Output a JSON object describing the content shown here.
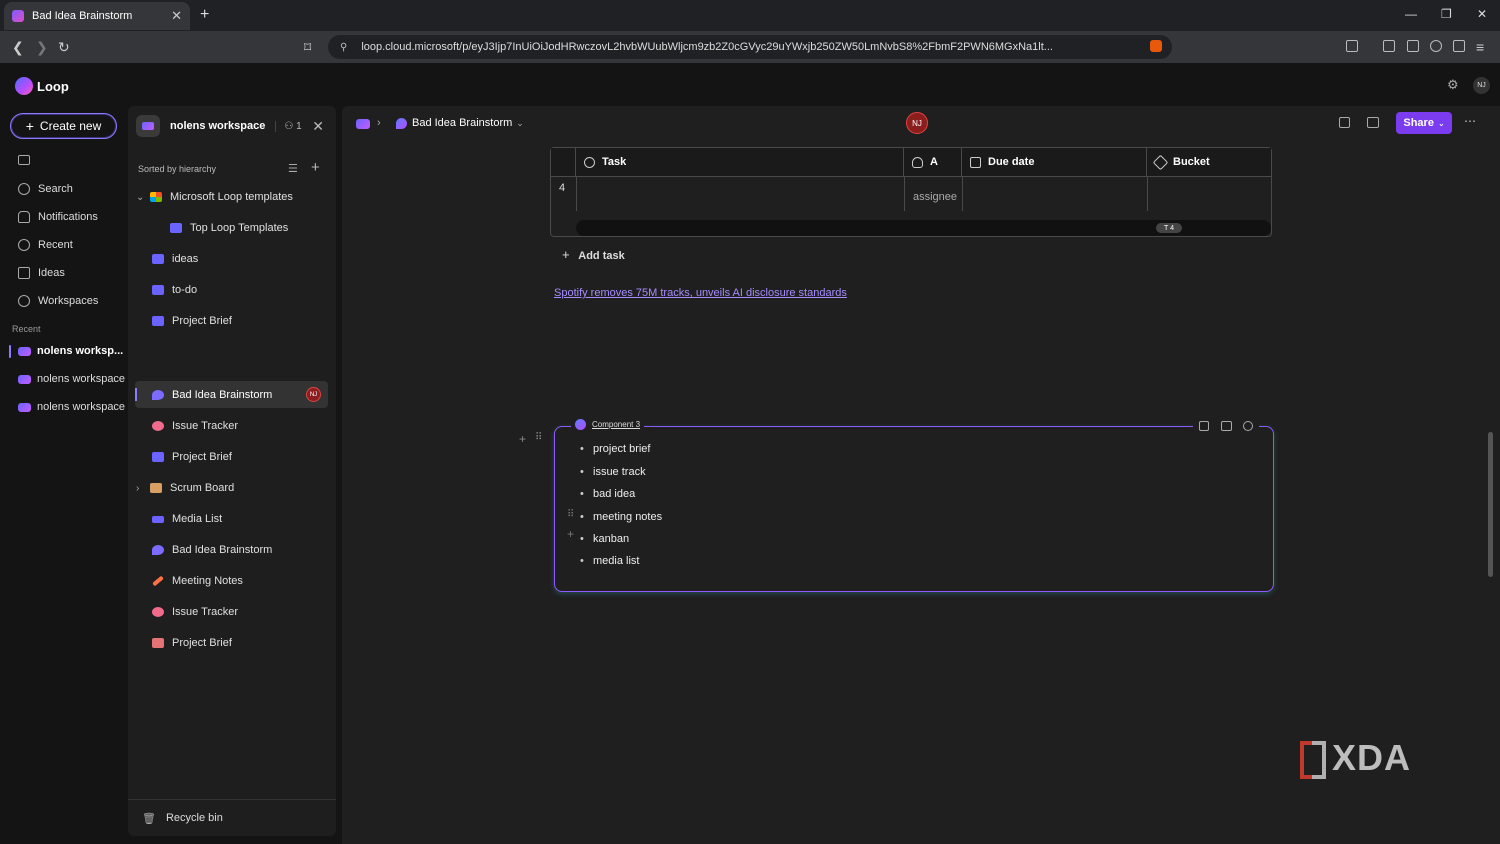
{
  "browser": {
    "tab_title": "Bad Idea Brainstorm",
    "url": "loop.cloud.microsoft/p/eyJ3Ijp7InUiOiJodHRwczovL2hvbWUubWljcm9zb2Z0cGVyc29uYWxjb250ZW50LmNvbS8%2FbmF2PWN6MGxNa1lt..."
  },
  "app": {
    "name": "Loop",
    "user_initials": "NJ"
  },
  "left_nav": {
    "create_new": "Create new",
    "items": [
      {
        "label": "Search"
      },
      {
        "label": "Notifications"
      },
      {
        "label": "Recent"
      },
      {
        "label": "Ideas"
      },
      {
        "label": "Workspaces"
      }
    ],
    "recent_label": "Recent",
    "recent": [
      {
        "label": "nolens worksp..."
      },
      {
        "label": "nolens workspace"
      },
      {
        "label": "nolens workspace"
      }
    ]
  },
  "workspace": {
    "name": "nolens workspace",
    "members": "1",
    "sort_label": "Sorted by hierarchy",
    "tree": [
      {
        "label": "Microsoft Loop templates",
        "color": "#f25022"
      },
      {
        "label": "Top Loop Templates",
        "color": "#6b63ff"
      },
      {
        "label": "ideas",
        "color": "#6b63ff"
      },
      {
        "label": "to-do",
        "color": "#6b63ff"
      },
      {
        "label": "Project Brief",
        "color": "#6b63ff"
      },
      {
        "label": "Bad Idea Brainstorm",
        "color": "#7b6cff"
      },
      {
        "label": "Issue Tracker",
        "color": "#f26b8a"
      },
      {
        "label": "Project Brief",
        "color": "#6b63ff"
      },
      {
        "label": "Scrum Board",
        "color": "#d9a066"
      },
      {
        "label": "Media List",
        "color": "#6b63ff"
      },
      {
        "label": "Bad Idea Brainstorm",
        "color": "#7b6cff"
      },
      {
        "label": "Meeting Notes",
        "color": "#ff7043"
      },
      {
        "label": "Issue Tracker",
        "color": "#f26b8a"
      },
      {
        "label": "Project Brief",
        "color": "#e57373"
      }
    ],
    "active_initials": "NJ",
    "recycle_bin": "Recycle bin"
  },
  "page": {
    "breadcrumb_title": "Bad Idea Brainstorm",
    "collaborator_initials": "NJ",
    "share_label": "Share",
    "table": {
      "headers": [
        "Task",
        "A",
        "Due date",
        "Bucket"
      ],
      "row_number": "4",
      "assignee_placeholder": "assignee",
      "scroll_badge": "T 4"
    },
    "add_task": "Add task",
    "news_link": "Spotify removes 75M tracks, unveils AI disclosure standards",
    "component": {
      "label": "Component 3",
      "items": [
        "project brief",
        "issue track",
        "bad idea",
        "meeting notes",
        "kanban",
        "media list"
      ]
    }
  },
  "watermark": "XDA"
}
